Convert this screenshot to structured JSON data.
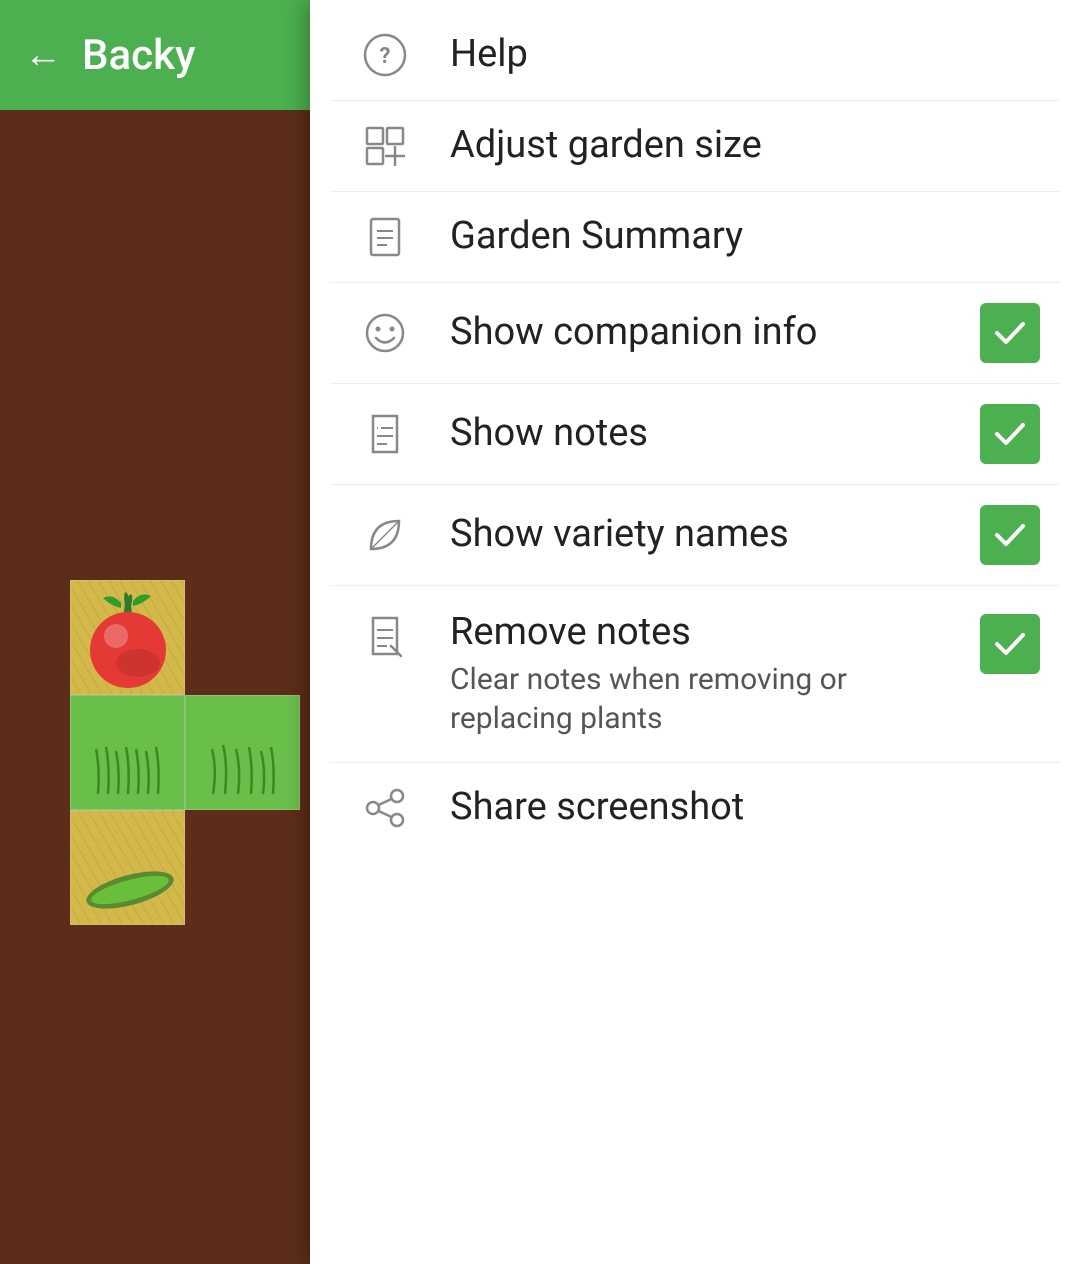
{
  "toolbar": {
    "back_label": "←",
    "title": "Backy"
  },
  "menu": {
    "items": [
      {
        "id": "help",
        "label": "Help",
        "sublabel": null,
        "icon": "help-icon",
        "checked": null
      },
      {
        "id": "adjust-garden",
        "label": "Adjust garden size",
        "sublabel": null,
        "icon": "grid-plus-icon",
        "checked": null
      },
      {
        "id": "garden-summary",
        "label": "Garden Summary",
        "sublabel": null,
        "icon": "document-icon",
        "checked": null
      },
      {
        "id": "show-companion",
        "label": "Show companion info",
        "sublabel": null,
        "icon": "smiley-icon",
        "checked": true
      },
      {
        "id": "show-notes",
        "label": "Show notes",
        "sublabel": null,
        "icon": "note-icon",
        "checked": true
      },
      {
        "id": "show-variety",
        "label": "Show variety names",
        "sublabel": null,
        "icon": "leaf-icon",
        "checked": true
      },
      {
        "id": "remove-notes",
        "label": "Remove notes",
        "sublabel": "Clear notes when removing or replacing plants",
        "icon": "remove-note-icon",
        "checked": true
      },
      {
        "id": "share-screenshot",
        "label": "Share screenshot",
        "sublabel": null,
        "icon": "share-icon",
        "checked": null
      }
    ]
  }
}
